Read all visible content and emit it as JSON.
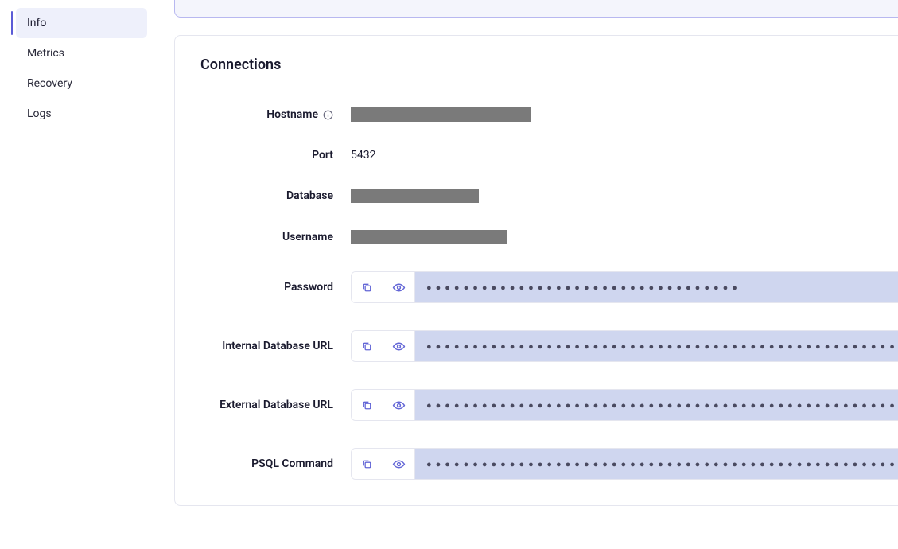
{
  "sidebar": {
    "items": [
      {
        "label": "Info",
        "active": true
      },
      {
        "label": "Metrics",
        "active": false
      },
      {
        "label": "Recovery",
        "active": false
      },
      {
        "label": "Logs",
        "active": false
      }
    ]
  },
  "connections": {
    "title": "Connections",
    "fields": {
      "hostname": {
        "label": "Hostname",
        "redacted": true
      },
      "port": {
        "label": "Port",
        "value": "5432"
      },
      "database": {
        "label": "Database",
        "redacted": true
      },
      "username": {
        "label": "Username",
        "redacted": true
      },
      "password": {
        "label": "Password",
        "masked": "●●●●●●●●●●●●●●●●●●●●●●●●●●●●●●●●●●"
      },
      "internal_url": {
        "label": "Internal Database URL",
        "masked_long": true
      },
      "external_url": {
        "label": "External Database URL",
        "masked_long": true
      },
      "psql": {
        "label": "PSQL Command",
        "masked_long": true
      }
    }
  }
}
